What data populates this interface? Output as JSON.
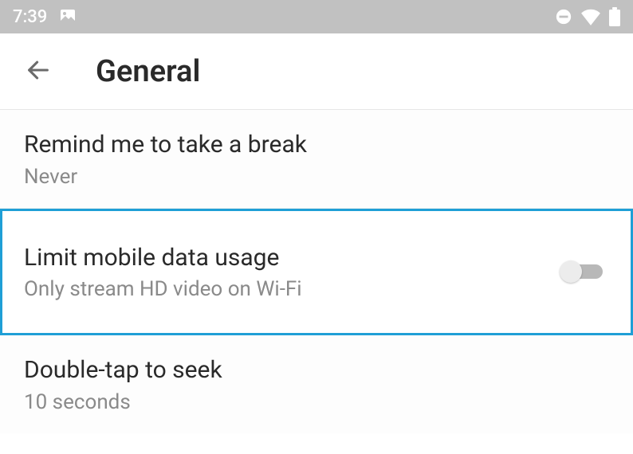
{
  "status": {
    "time": "7:39"
  },
  "appbar": {
    "title": "General"
  },
  "rows": {
    "break": {
      "title": "Remind me to take a break",
      "sub": "Never"
    },
    "data": {
      "title": "Limit mobile data usage",
      "sub": "Only stream HD video on Wi-Fi",
      "toggle": false
    },
    "seek": {
      "title": "Double-tap to seek",
      "sub": "10 seconds"
    }
  },
  "colors": {
    "highlight": "#1f9fd6"
  }
}
